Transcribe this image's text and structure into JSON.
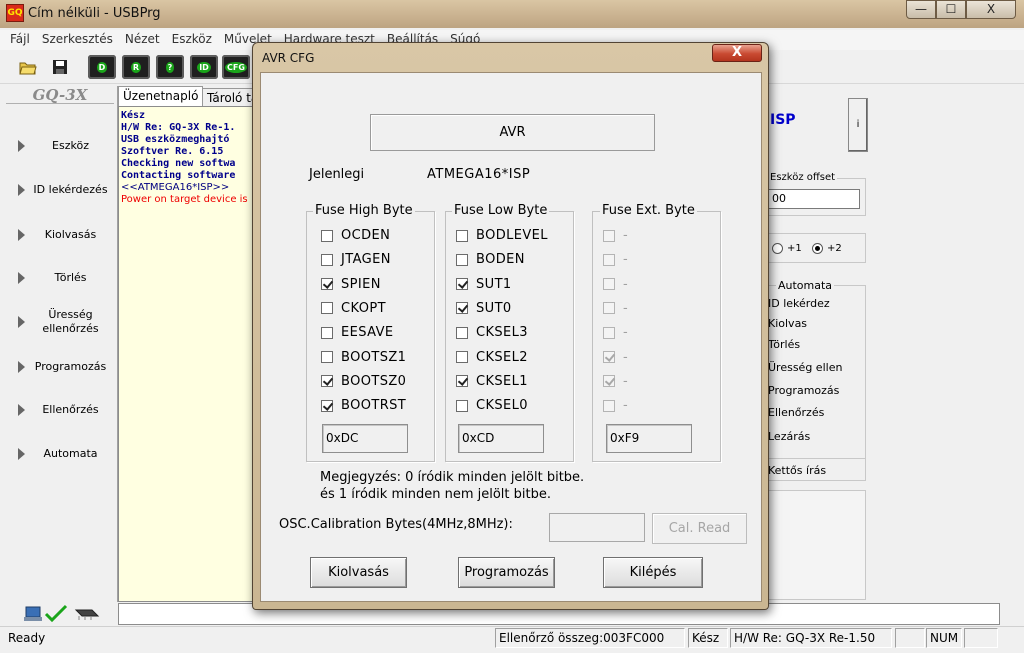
{
  "window": {
    "app_icon": "GQ",
    "title": "Cím nélküli - USBPrg",
    "min": "—",
    "max": "☐",
    "close": "X"
  },
  "menu": [
    "Fájl",
    "Szerkesztés",
    "Nézet",
    "Eszköz",
    "Művelet",
    "Hardware teszt",
    "Beállítás",
    "Súgó"
  ],
  "toolbar": {
    "buttons": [
      "D",
      "R",
      "?",
      "ID",
      "CFG"
    ]
  },
  "sidebar": {
    "logo": "GQ-3X",
    "items": [
      {
        "label": "Eszköz"
      },
      {
        "label": "ID lekérdezés"
      },
      {
        "label": "Kiolvasás"
      },
      {
        "label": "Törlés"
      },
      {
        "label": "Üresség ellenőrzés"
      },
      {
        "label": "Programozás"
      },
      {
        "label": "Ellenőrzés"
      },
      {
        "label": "Automata"
      }
    ]
  },
  "tabs": {
    "log": "Üzenetnapló",
    "buffer": "Tároló ta"
  },
  "log": [
    {
      "text": "Kész",
      "style": "blue"
    },
    {
      "text": "H/W Re: GQ-3X Re-1.",
      "style": "blue"
    },
    {
      "text": "USB eszközmeghajtó",
      "style": "blue"
    },
    {
      "text": "Szoftver Re. 6.15",
      "style": "blue"
    },
    {
      "text": "Checking new softwa",
      "style": "blue"
    },
    {
      "text": "Contacting software",
      "style": "blue"
    },
    {
      "text": "<<ATMEGA16*ISP>>",
      "style": "plain"
    },
    {
      "text": "Power on target device is",
      "style": "red"
    }
  ],
  "right_panel": {
    "isp": "ISP",
    "info_button": "i",
    "offset_label": "Eszköz offset",
    "offset_value": "00",
    "radio_plus1": "+1",
    "radio_plus2": "+2",
    "auto_label": "Automata",
    "auto_items": [
      "ID lekérdez",
      "Kiolvas",
      "Törlés",
      "Üresség ellen",
      "Programozás",
      "Ellenőrzés",
      "Lezárás"
    ],
    "double_write": "Kettős írás"
  },
  "status": {
    "ready": "Ready",
    "checksum": "Ellenőrző összeg:003FC000",
    "state": "Kész",
    "hw": "H/W Re: GQ-3X Re-1.50",
    "num": "NUM"
  },
  "dialog": {
    "title": "AVR CFG",
    "close": "X",
    "family": "AVR",
    "current_label": "Jelenlegi",
    "current_chip": "ATMEGA16*ISP",
    "high": {
      "legend": "Fuse High Byte",
      "bits": [
        {
          "name": "OCDEN",
          "checked": false
        },
        {
          "name": "JTAGEN",
          "checked": false
        },
        {
          "name": "SPIEN",
          "checked": true
        },
        {
          "name": "CKOPT",
          "checked": false
        },
        {
          "name": "EESAVE",
          "checked": false
        },
        {
          "name": "BOOTSZ1",
          "checked": false
        },
        {
          "name": "BOOTSZ0",
          "checked": true
        },
        {
          "name": "BOOTRST",
          "checked": true
        }
      ],
      "value": "0xDC"
    },
    "low": {
      "legend": "Fuse Low Byte",
      "bits": [
        {
          "name": "BODLEVEL",
          "checked": false
        },
        {
          "name": "BODEN",
          "checked": false
        },
        {
          "name": "SUT1",
          "checked": true
        },
        {
          "name": "SUT0",
          "checked": true
        },
        {
          "name": "CKSEL3",
          "checked": false
        },
        {
          "name": "CKSEL2",
          "checked": false
        },
        {
          "name": "CKSEL1",
          "checked": true
        },
        {
          "name": "CKSEL0",
          "checked": false
        }
      ],
      "value": "0xCD"
    },
    "ext": {
      "legend": "Fuse Ext. Byte",
      "bits": [
        {
          "name": "-",
          "checked": false
        },
        {
          "name": "-",
          "checked": false
        },
        {
          "name": "-",
          "checked": false
        },
        {
          "name": "-",
          "checked": false
        },
        {
          "name": "-",
          "checked": false
        },
        {
          "name": "-",
          "checked": true
        },
        {
          "name": "-",
          "checked": true
        },
        {
          "name": "-",
          "checked": false
        }
      ],
      "value": "0xF9"
    },
    "note_line1": "Megjegyzés: 0 íródik minden jelölt bitbe.",
    "note_line2": "és 1 íródik minden nem jelölt bitbe.",
    "osc_label": "OSC.Calibration Bytes(4MHz,8MHz):",
    "osc_value": "",
    "cal_read": "Cal. Read",
    "btn_read": "Kiolvasás",
    "btn_program": "Programozás",
    "btn_exit": "Kilépés"
  }
}
